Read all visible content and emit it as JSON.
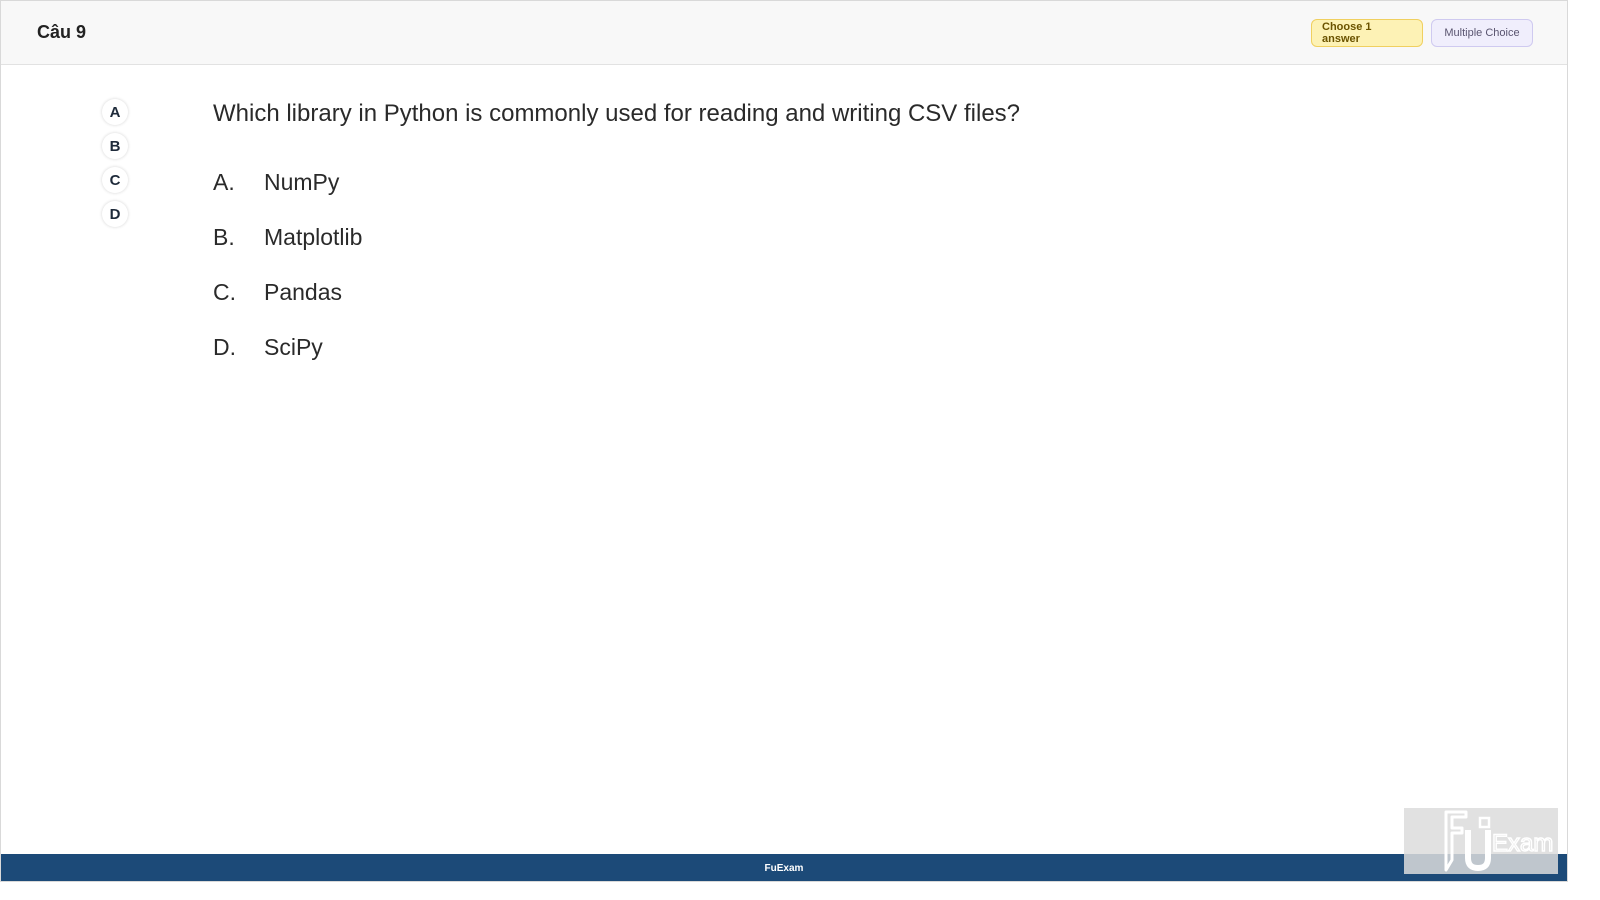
{
  "header": {
    "question_number": "Câu 9",
    "badge_choose": "Choose 1 answer",
    "badge_type": "Multiple Choice"
  },
  "answer_nav": [
    "A",
    "B",
    "C",
    "D"
  ],
  "question": {
    "text": "Which library in Python is commonly used for reading and writing CSV files?",
    "options": [
      {
        "letter": "A.",
        "text": "NumPy"
      },
      {
        "letter": "B.",
        "text": "Matplotlib"
      },
      {
        "letter": "C.",
        "text": "Pandas"
      },
      {
        "letter": "D.",
        "text": "SciPy"
      }
    ]
  },
  "footer": {
    "text": "FuExam"
  },
  "logo": {
    "text": "Exam"
  }
}
